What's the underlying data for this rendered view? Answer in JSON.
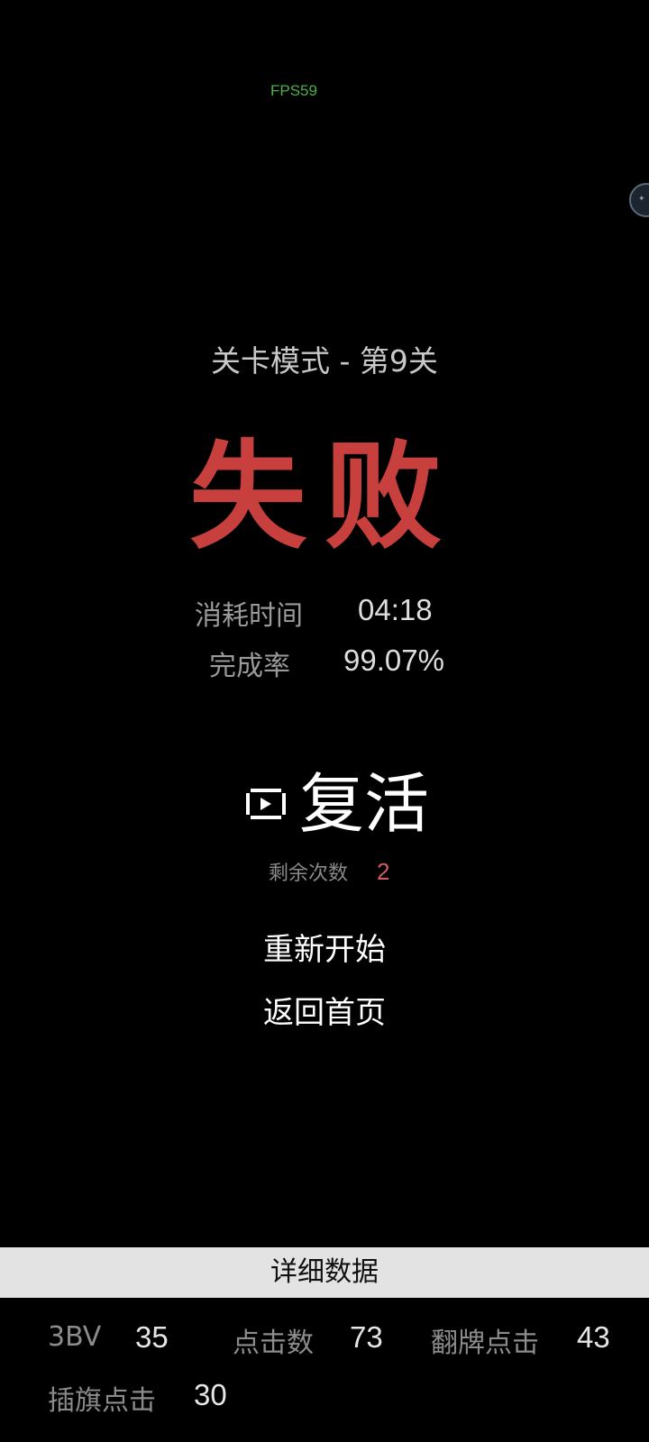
{
  "fps_overlay": "FPS59",
  "level_title": "关卡模式 - 第9关",
  "result": "失败",
  "stats": {
    "time_label": "消耗时间",
    "time_value": "04:18",
    "completion_label": "完成率",
    "completion_value": "99.07%"
  },
  "revive": {
    "label": "复活",
    "icon": "video-play-icon",
    "remaining_label": "剩余次数",
    "remaining_count": "2"
  },
  "buttons": {
    "restart": "重新开始",
    "home": "返回首页"
  },
  "details": {
    "header": "详细数据",
    "items": [
      {
        "label": "3BV",
        "value": "35"
      },
      {
        "label": "点击数",
        "value": "73"
      },
      {
        "label": "翻牌点击",
        "value": "43"
      },
      {
        "label": "插旗点击",
        "value": "30"
      }
    ]
  },
  "colors": {
    "background": "#000000",
    "fail_red": "#c7403d",
    "count_red": "#d25a64",
    "fps_green": "#4cb04c",
    "detail_bar": "#e3e3e3"
  }
}
